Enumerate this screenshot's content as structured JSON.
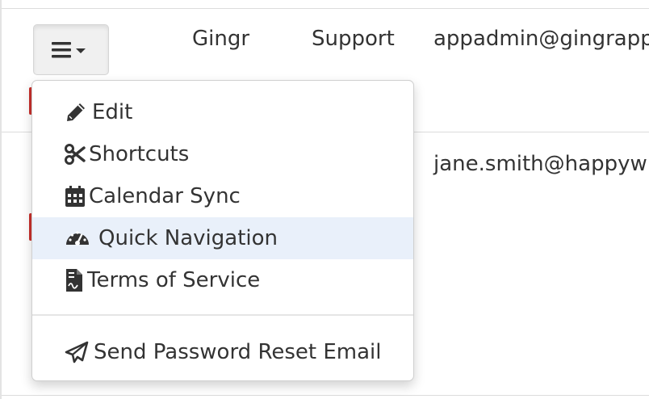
{
  "rows": [
    {
      "first_name": "Gingr",
      "last_name": "Support",
      "email": "appadmin@gingrapp"
    },
    {
      "email": "jane.smith@happyw"
    }
  ],
  "action_menu": {
    "toggle_icon": "bars-caret-icon",
    "items": [
      {
        "label": "Edit",
        "icon": "pencil-icon"
      },
      {
        "label": "Shortcuts",
        "icon": "scissors-icon"
      },
      {
        "label": "Calendar Sync",
        "icon": "calendar-icon"
      },
      {
        "label": "Quick Navigation",
        "icon": "dashboard-icon",
        "highlighted": true
      },
      {
        "label": "Terms of Service",
        "icon": "file-contract-icon"
      },
      {
        "label": "Send Password Reset Email",
        "icon": "paper-plane-icon"
      }
    ]
  },
  "colors": {
    "highlight": "#e9f0fa",
    "danger_edge": "#c9302c",
    "text": "#333333"
  }
}
